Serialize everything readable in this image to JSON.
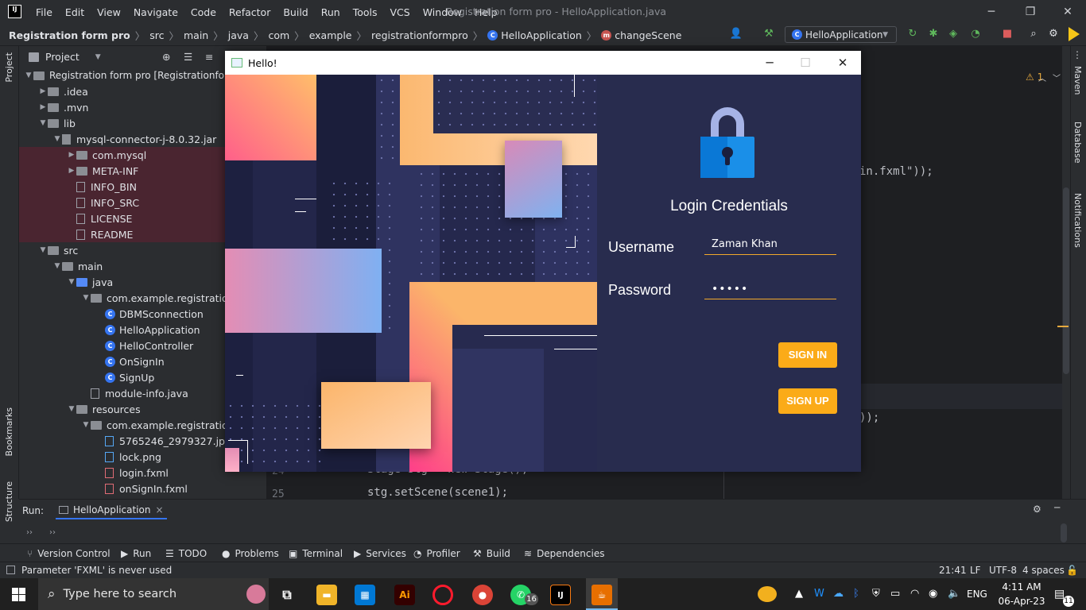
{
  "ide": {
    "app_logo": "IJ",
    "menu": [
      "File",
      "Edit",
      "View",
      "Navigate",
      "Code",
      "Refactor",
      "Build",
      "Run",
      "Tools",
      "VCS",
      "Window",
      "Help"
    ],
    "window_title": "Registration form pro - HelloApplication.java",
    "breadcrumb": [
      "Registration form pro",
      "src",
      "main",
      "java",
      "com",
      "example",
      "registrationformpro",
      "HelloApplication",
      "changeScene"
    ],
    "run_config": "HelloApplication",
    "left_tabs": [
      "Project",
      "Bookmarks",
      "Structure"
    ],
    "right_tabs": [
      "Maven",
      "Database",
      "Notifications"
    ],
    "project_header": "Project",
    "warning_count": "1",
    "tree": [
      {
        "label": "Registration form pro [Registrationform",
        "depth": 0,
        "kind": "folder",
        "open": true
      },
      {
        "label": ".idea",
        "depth": 1,
        "kind": "folder",
        "open": false
      },
      {
        "label": ".mvn",
        "depth": 1,
        "kind": "folder",
        "open": false
      },
      {
        "label": "lib",
        "depth": 1,
        "kind": "folder",
        "open": true
      },
      {
        "label": "mysql-connector-j-8.0.32.jar",
        "depth": 2,
        "kind": "jar",
        "open": true
      },
      {
        "label": "com.mysql",
        "depth": 3,
        "kind": "folder",
        "open": false,
        "hl": true
      },
      {
        "label": "META-INF",
        "depth": 3,
        "kind": "folder",
        "open": false,
        "hl": true
      },
      {
        "label": "INFO_BIN",
        "depth": 3,
        "kind": "file",
        "hl": true
      },
      {
        "label": "INFO_SRC",
        "depth": 3,
        "kind": "file",
        "hl": true
      },
      {
        "label": "LICENSE",
        "depth": 3,
        "kind": "file",
        "hl": true
      },
      {
        "label": "README",
        "depth": 3,
        "kind": "file",
        "hl": true
      },
      {
        "label": "src",
        "depth": 1,
        "kind": "folder",
        "open": true
      },
      {
        "label": "main",
        "depth": 2,
        "kind": "folder",
        "open": true
      },
      {
        "label": "java",
        "depth": 3,
        "kind": "bluefolder",
        "open": true
      },
      {
        "label": "com.example.registrationfo",
        "depth": 4,
        "kind": "folder",
        "open": true
      },
      {
        "label": "DBMSconnection",
        "depth": 5,
        "kind": "class"
      },
      {
        "label": "HelloApplication",
        "depth": 5,
        "kind": "class"
      },
      {
        "label": "HelloController",
        "depth": 5,
        "kind": "class"
      },
      {
        "label": "OnSignIn",
        "depth": 5,
        "kind": "class"
      },
      {
        "label": "SignUp",
        "depth": 5,
        "kind": "class"
      },
      {
        "label": "module-info.java",
        "depth": 4,
        "kind": "file"
      },
      {
        "label": "resources",
        "depth": 3,
        "kind": "folder",
        "open": true
      },
      {
        "label": "com.example.registrationfo",
        "depth": 4,
        "kind": "folder",
        "open": true
      },
      {
        "label": "5765246_2979327.jpg",
        "depth": 5,
        "kind": "img"
      },
      {
        "label": "lock.png",
        "depth": 5,
        "kind": "img"
      },
      {
        "label": "login.fxml",
        "depth": 5,
        "kind": "xml"
      },
      {
        "label": "onSignIn.fxml",
        "depth": 5,
        "kind": "xml"
      }
    ],
    "code_fragments": [
      "in.fxml\"));",
      "));",
      "Stage stg = new Stage();",
      "stg.setScene(scene1);"
    ],
    "line_numbers": [
      "24",
      "25"
    ],
    "run_label": "Run:",
    "run_tab": "HelloApplication",
    "bottom_tools": [
      "Version Control",
      "Run",
      "TODO",
      "Problems",
      "Terminal",
      "Services",
      "Profiler",
      "Build",
      "Dependencies"
    ],
    "status_message": "Parameter 'FXML' is never used",
    "status_right": [
      "21:41",
      "LF",
      "UTF-8",
      "4 spaces"
    ]
  },
  "dialog": {
    "title": "Hello!",
    "heading": "Login Credentials",
    "username_label": "Username",
    "username_value": "Zaman Khan",
    "password_label": "Password",
    "password_value": "•••••",
    "signin_label": "SIGN IN",
    "signup_label": "SIGN UP",
    "accent_color": "#fbab18",
    "background_color": "#282c4e"
  },
  "taskbar": {
    "search_placeholder": "Type here to search",
    "language": "ENG",
    "time": "4:11 AM",
    "date": "06-Apr-23",
    "whatsapp_badge": "16",
    "notification_count": "11"
  }
}
